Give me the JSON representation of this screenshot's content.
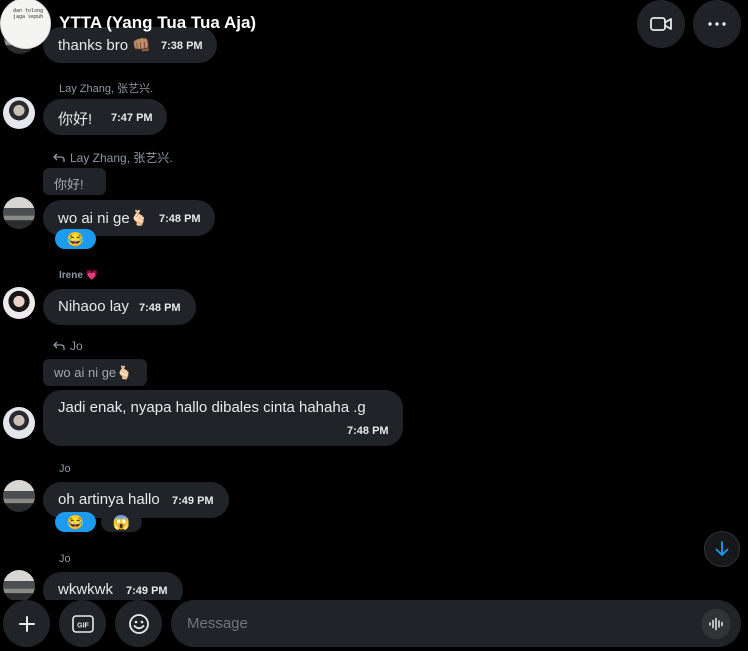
{
  "header": {
    "title": "YTTA (Yang Tua Tua Aja)",
    "avatar_text": "dan tolong\njaga sepuh"
  },
  "messages": [
    {
      "id": "m1",
      "text": "thanks bro 👊🏽",
      "time": "7:38 PM"
    },
    {
      "id": "m2",
      "sender": "Lay Zhang, 张艺兴.",
      "text": "你好!",
      "time": "7:47 PM"
    },
    {
      "id": "m3",
      "reply_to": "Lay Zhang, 张艺兴.",
      "quote": "你好!",
      "text": "wo ai ni ge🫰🏻",
      "time": "7:48 PM",
      "reactions": [
        "😂"
      ]
    },
    {
      "id": "m4",
      "sender": "Irene 💗",
      "text": "Nihaoo lay",
      "time": "7:48 PM"
    },
    {
      "id": "m5",
      "reply_to": "Jo",
      "quote": "wo ai ni ge🫰🏻",
      "text": "Jadi enak, nyapa hallo dibales cinta hahaha .g",
      "time": "7:48 PM"
    },
    {
      "id": "m6",
      "sender": "Jo",
      "text": "oh artinya hallo",
      "time": "7:49 PM",
      "reactions": [
        "😂",
        "😱"
      ]
    },
    {
      "id": "m7",
      "sender": "Jo",
      "text": "wkwkwk",
      "time": "7:49 PM"
    }
  ],
  "composer": {
    "placeholder": "Message",
    "gif_label": "GIF"
  },
  "icons": {
    "video_call": "video-camera-icon",
    "more": "more-horizontal-icon",
    "scroll_down": "arrow-down-icon",
    "add": "plus-icon",
    "gif": "gif-icon",
    "emoji": "emoji-icon",
    "voice": "voice-waveform-icon",
    "reply": "reply-arrow-icon"
  },
  "colors": {
    "background": "#000000",
    "bubble": "#202327",
    "accent": "#1d9bf0",
    "muted_text": "#8b98a5"
  }
}
